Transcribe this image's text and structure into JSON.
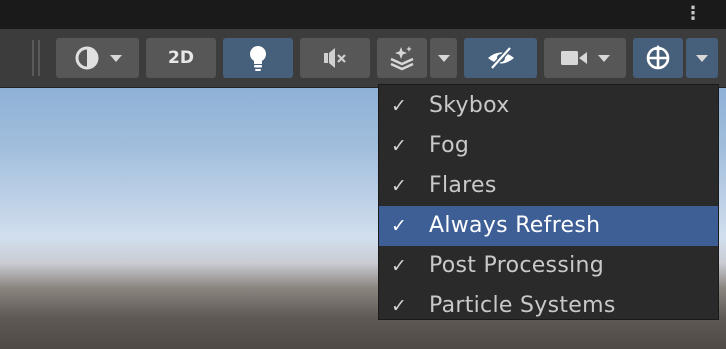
{
  "toolbar": {
    "two_d_label": "2D",
    "colors": {
      "button": "#575757",
      "active_button": "#46607c",
      "toolbar_bg": "#3c3c3c"
    },
    "icons": [
      "shading-mode-icon",
      "lighting-bulb-icon",
      "audio-mute-icon",
      "effects-icon",
      "hidden-objects-icon",
      "camera-icon",
      "gizmos-icon"
    ]
  },
  "menu": {
    "items": [
      {
        "label": "Skybox",
        "checked": true,
        "selected": false
      },
      {
        "label": "Fog",
        "checked": true,
        "selected": false
      },
      {
        "label": "Flares",
        "checked": true,
        "selected": false
      },
      {
        "label": "Always Refresh",
        "checked": true,
        "selected": true
      },
      {
        "label": "Post Processing",
        "checked": true,
        "selected": false
      },
      {
        "label": "Particle Systems",
        "checked": true,
        "selected": false
      }
    ],
    "check_glyph": "✓",
    "colors": {
      "background": "#2a2a2a",
      "highlight": "#3e5f96",
      "text": "#c9c9c9"
    }
  }
}
